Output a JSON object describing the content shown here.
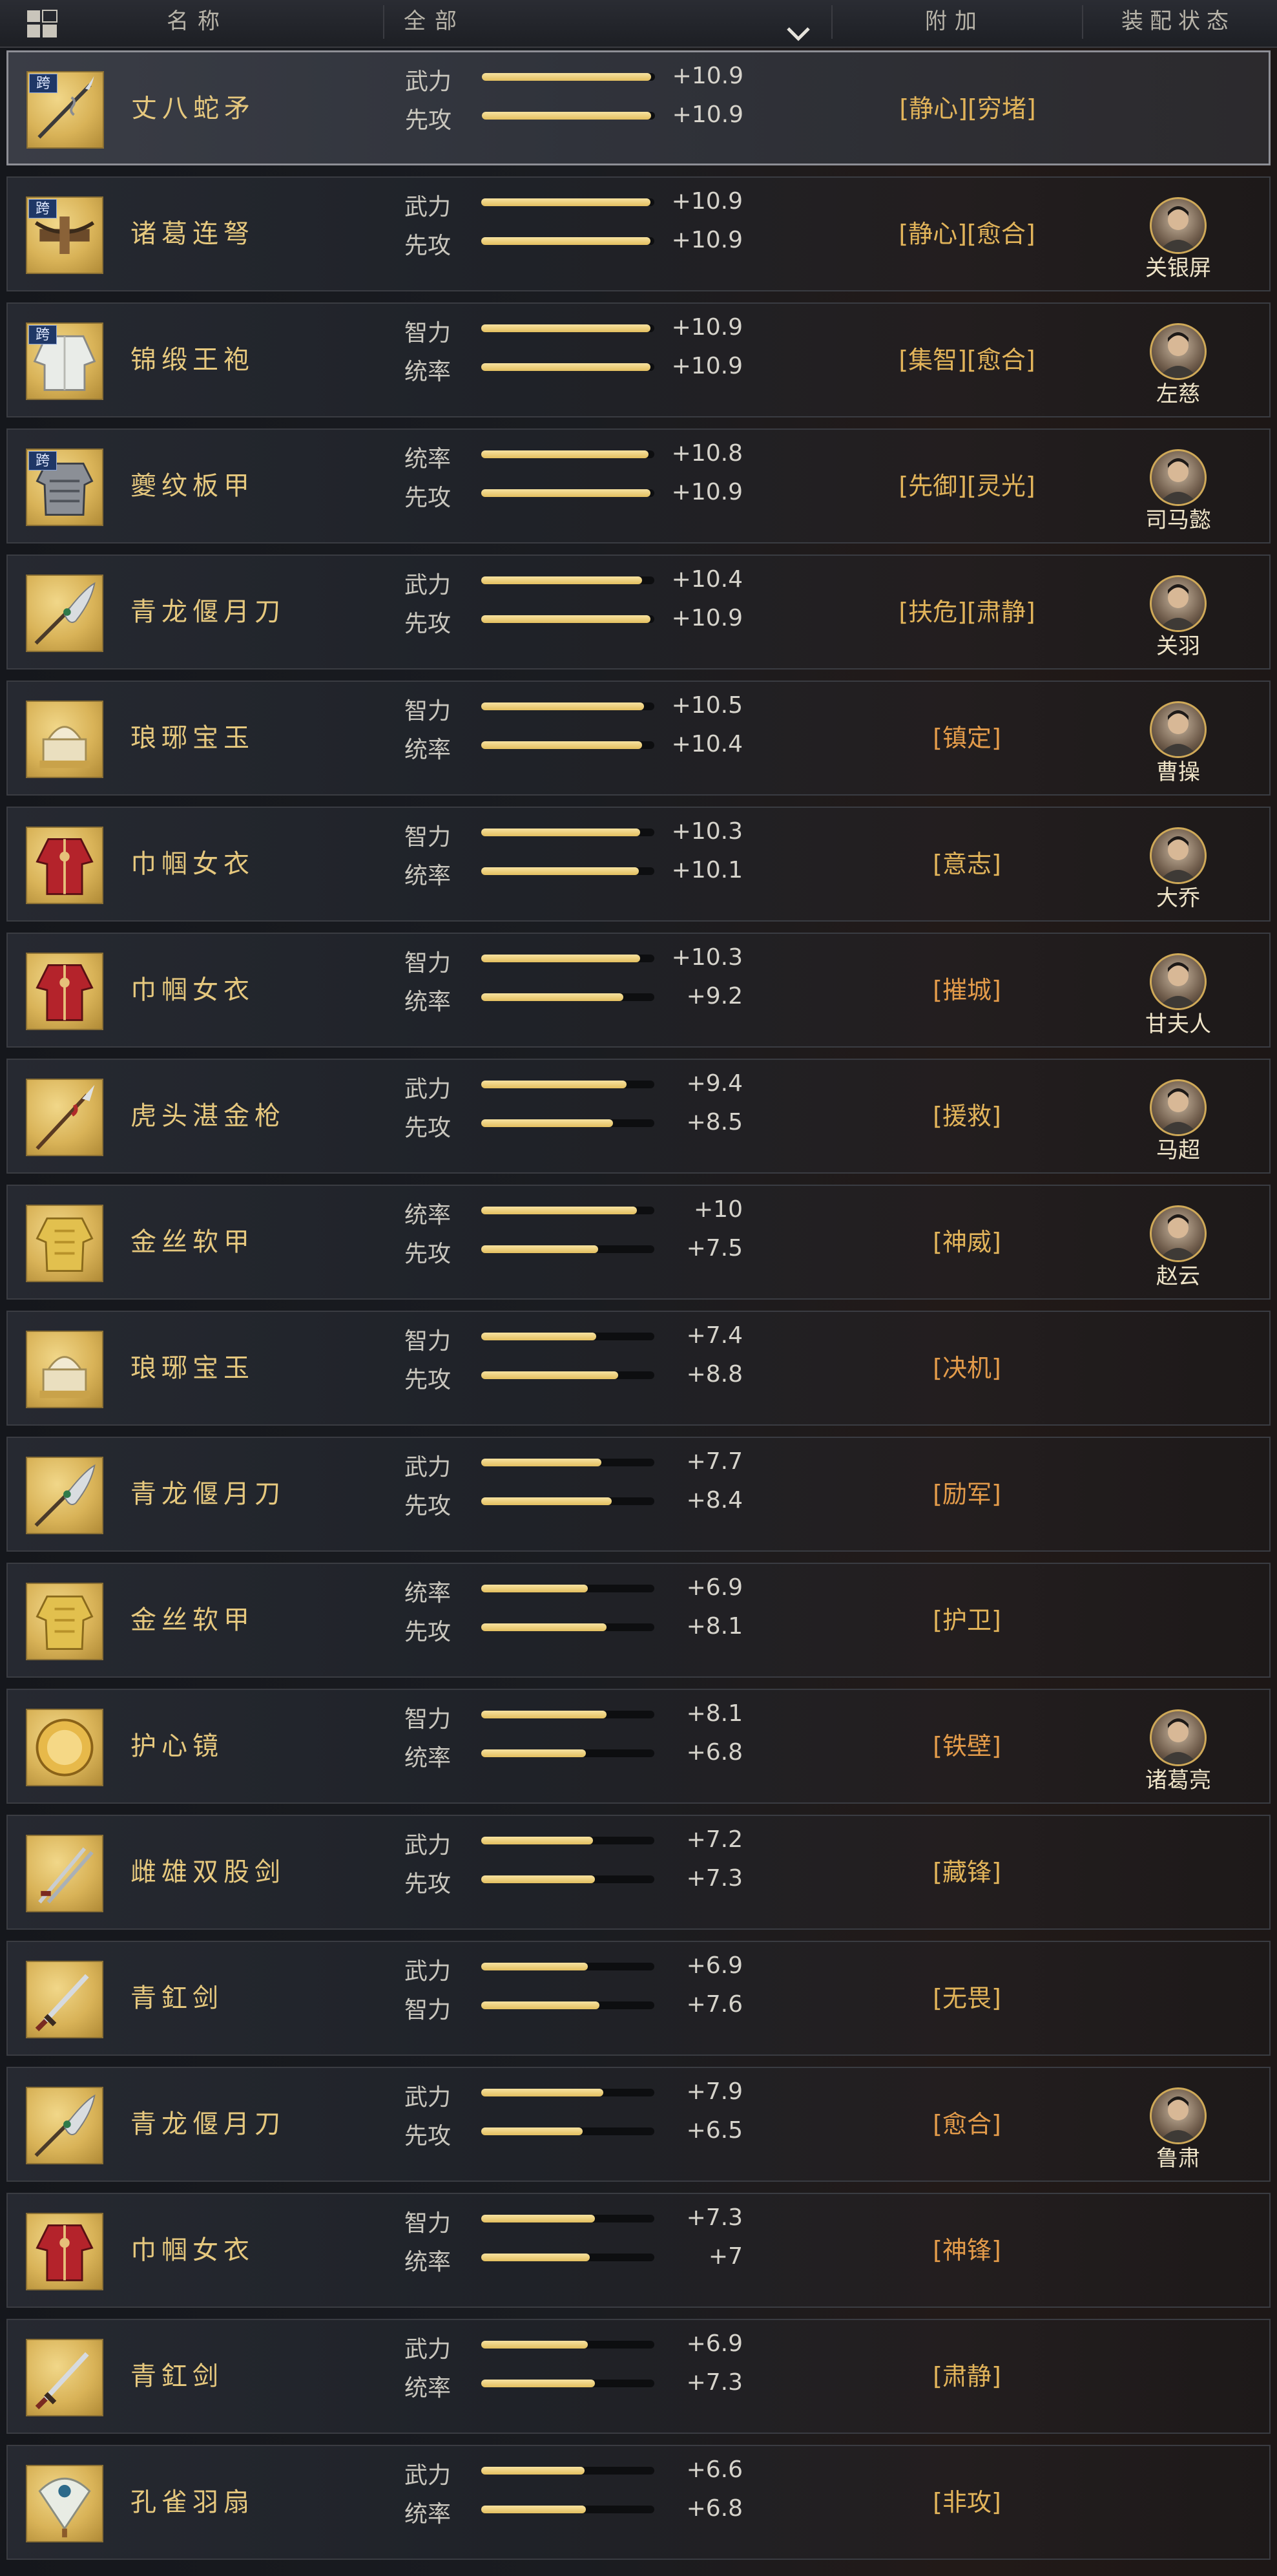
{
  "header": {
    "name_label": "名称",
    "filter_label": "全部",
    "extra_label": "附加",
    "status_label": "装配状态"
  },
  "cross_badge": "跨",
  "rows": [
    {
      "name": "丈八蛇矛",
      "icon": "serpent-spear-icon",
      "cross": true,
      "selected": true,
      "stat1": {
        "label": "武力",
        "value": "+10.9",
        "fill": 1.0
      },
      "stat2": {
        "label": "先攻",
        "value": "+10.9",
        "fill": 1.0
      },
      "extra": "[静心][穷堵]",
      "extra_color": "yellow",
      "hero": ""
    },
    {
      "name": "诸葛连弩",
      "icon": "repeating-crossbow-icon",
      "cross": true,
      "stat1": {
        "label": "武力",
        "value": "+10.9",
        "fill": 1.0
      },
      "stat2": {
        "label": "先攻",
        "value": "+10.9",
        "fill": 1.0
      },
      "extra": "[静心][愈合]",
      "extra_color": "yellow",
      "hero": "关银屏"
    },
    {
      "name": "锦缎王袍",
      "icon": "brocade-robe-icon",
      "cross": true,
      "stat1": {
        "label": "智力",
        "value": "+10.9",
        "fill": 1.0
      },
      "stat2": {
        "label": "统率",
        "value": "+10.9",
        "fill": 1.0
      },
      "extra": "[集智][愈合]",
      "extra_color": "yellow",
      "hero": "左慈"
    },
    {
      "name": "夔纹板甲",
      "icon": "plate-armor-icon",
      "cross": true,
      "stat1": {
        "label": "统率",
        "value": "+10.8",
        "fill": 0.99
      },
      "stat2": {
        "label": "先攻",
        "value": "+10.9",
        "fill": 1.0
      },
      "extra": "[先御][灵光]",
      "extra_color": "yellow",
      "hero": "司马懿"
    },
    {
      "name": "青龙偃月刀",
      "icon": "crescent-blade-icon",
      "cross": false,
      "stat1": {
        "label": "武力",
        "value": "+10.4",
        "fill": 0.95
      },
      "stat2": {
        "label": "先攻",
        "value": "+10.9",
        "fill": 1.0
      },
      "extra": "[扶危][肃静]",
      "extra_color": "yellow",
      "hero": "关羽"
    },
    {
      "name": "琅琊宝玉",
      "icon": "jade-seal-icon",
      "cross": false,
      "stat1": {
        "label": "智力",
        "value": "+10.5",
        "fill": 0.96
      },
      "stat2": {
        "label": "统率",
        "value": "+10.4",
        "fill": 0.95
      },
      "extra": "[镇定]",
      "extra_color": "orange",
      "hero": "曹操"
    },
    {
      "name": "巾帼女衣",
      "icon": "heroine-garment-icon",
      "cross": false,
      "stat1": {
        "label": "智力",
        "value": "+10.3",
        "fill": 0.94
      },
      "stat2": {
        "label": "统率",
        "value": "+10.1",
        "fill": 0.93
      },
      "extra": "[意志]",
      "extra_color": "yellow",
      "hero": "大乔"
    },
    {
      "name": "巾帼女衣",
      "icon": "heroine-garment-icon",
      "cross": false,
      "stat1": {
        "label": "智力",
        "value": "+10.3",
        "fill": 0.94
      },
      "stat2": {
        "label": "统率",
        "value": "+9.2",
        "fill": 0.84
      },
      "extra": "[摧城]",
      "extra_color": "orange",
      "hero": "甘夫人"
    },
    {
      "name": "虎头湛金枪",
      "icon": "tiger-spear-icon",
      "cross": false,
      "stat1": {
        "label": "武力",
        "value": "+9.4",
        "fill": 0.86
      },
      "stat2": {
        "label": "先攻",
        "value": "+8.5",
        "fill": 0.78
      },
      "extra": "[援救]",
      "extra_color": "yellow",
      "hero": "马超"
    },
    {
      "name": "金丝软甲",
      "icon": "golden-armor-icon",
      "cross": false,
      "stat1": {
        "label": "统率",
        "value": "+10",
        "fill": 0.92
      },
      "stat2": {
        "label": "先攻",
        "value": "+7.5",
        "fill": 0.69
      },
      "extra": "[神威]",
      "extra_color": "yellow",
      "hero": "赵云"
    },
    {
      "name": "琅琊宝玉",
      "icon": "jade-seal-icon",
      "cross": false,
      "stat1": {
        "label": "智力",
        "value": "+7.4",
        "fill": 0.68
      },
      "stat2": {
        "label": "先攻",
        "value": "+8.8",
        "fill": 0.81
      },
      "extra": "[决机]",
      "extra_color": "orange",
      "hero": ""
    },
    {
      "name": "青龙偃月刀",
      "icon": "crescent-blade-icon",
      "cross": false,
      "stat1": {
        "label": "武力",
        "value": "+7.7",
        "fill": 0.71
      },
      "stat2": {
        "label": "先攻",
        "value": "+8.4",
        "fill": 0.77
      },
      "extra": "[励军]",
      "extra_color": "orange",
      "hero": ""
    },
    {
      "name": "金丝软甲",
      "icon": "golden-armor-icon",
      "cross": false,
      "stat1": {
        "label": "统率",
        "value": "+6.9",
        "fill": 0.63
      },
      "stat2": {
        "label": "先攻",
        "value": "+8.1",
        "fill": 0.74
      },
      "extra": "[护卫]",
      "extra_color": "yellow",
      "hero": ""
    },
    {
      "name": "护心镜",
      "icon": "heart-mirror-icon",
      "cross": false,
      "stat1": {
        "label": "智力",
        "value": "+8.1",
        "fill": 0.74
      },
      "stat2": {
        "label": "统率",
        "value": "+6.8",
        "fill": 0.62
      },
      "extra": "[铁壁]",
      "extra_color": "orange",
      "hero": "诸葛亮"
    },
    {
      "name": "雌雄双股剑",
      "icon": "twin-swords-icon",
      "cross": false,
      "stat1": {
        "label": "武力",
        "value": "+7.2",
        "fill": 0.66
      },
      "stat2": {
        "label": "先攻",
        "value": "+7.3",
        "fill": 0.67
      },
      "extra": "[藏锋]",
      "extra_color": "yellow",
      "hero": ""
    },
    {
      "name": "青釭剑",
      "icon": "qinggang-sword-icon",
      "cross": false,
      "stat1": {
        "label": "武力",
        "value": "+6.9",
        "fill": 0.63
      },
      "stat2": {
        "label": "智力",
        "value": "+7.6",
        "fill": 0.7
      },
      "extra": "[无畏]",
      "extra_color": "yellow",
      "hero": ""
    },
    {
      "name": "青龙偃月刀",
      "icon": "crescent-blade-icon",
      "cross": false,
      "stat1": {
        "label": "武力",
        "value": "+7.9",
        "fill": 0.72
      },
      "stat2": {
        "label": "先攻",
        "value": "+6.5",
        "fill": 0.6
      },
      "extra": "[愈合]",
      "extra_color": "orange",
      "hero": "鲁肃"
    },
    {
      "name": "巾帼女衣",
      "icon": "heroine-garment-icon",
      "cross": false,
      "stat1": {
        "label": "智力",
        "value": "+7.3",
        "fill": 0.67
      },
      "stat2": {
        "label": "统率",
        "value": "+7",
        "fill": 0.64
      },
      "extra": "[神锋]",
      "extra_color": "orange",
      "hero": ""
    },
    {
      "name": "青釭剑",
      "icon": "qinggang-sword-icon",
      "cross": false,
      "stat1": {
        "label": "武力",
        "value": "+6.9",
        "fill": 0.63
      },
      "stat2": {
        "label": "统率",
        "value": "+7.3",
        "fill": 0.67
      },
      "extra": "[肃静]",
      "extra_color": "yellow",
      "hero": ""
    },
    {
      "name": "孔雀羽扇",
      "icon": "peacock-fan-icon",
      "cross": false,
      "stat1": {
        "label": "武力",
        "value": "+6.6",
        "fill": 0.61
      },
      "stat2": {
        "label": "统率",
        "value": "+6.8",
        "fill": 0.62
      },
      "extra": "[非攻]",
      "extra_color": "yellow",
      "hero": ""
    }
  ]
}
